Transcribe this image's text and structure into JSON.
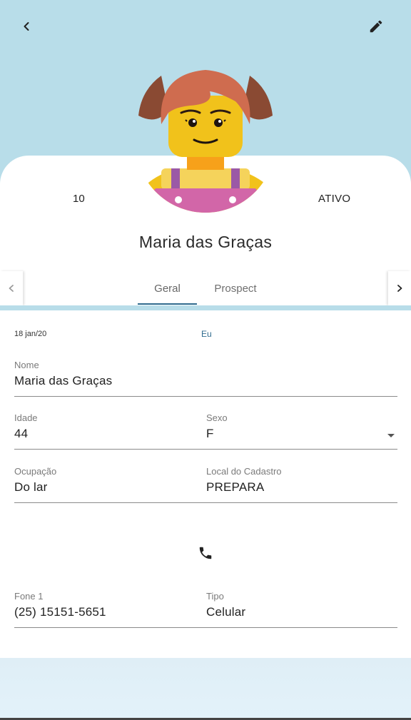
{
  "header": {
    "back_icon": "chevron-left-icon",
    "edit_icon": "pencil-icon",
    "background_color": "#b8dde9"
  },
  "profile": {
    "avatar": "lego-girl-avatar",
    "stat_left": "10",
    "stat_right": "ATIVO",
    "name": "Maria das Graças"
  },
  "tabs": {
    "items": [
      {
        "label": "Geral",
        "active": true
      },
      {
        "label": "Prospect",
        "active": false
      }
    ],
    "accent_color": "#2f6b8e"
  },
  "form": {
    "date": "18 jan/20",
    "author": "Eu",
    "fields": {
      "nome": {
        "label": "Nome",
        "value": "Maria das Graças"
      },
      "idade": {
        "label": "Idade",
        "value": "44"
      },
      "sexo": {
        "label": "Sexo",
        "value": "F"
      },
      "ocupacao": {
        "label": "Ocupação",
        "value": "Do lar"
      },
      "local": {
        "label": "Local do Cadastro",
        "value": "PREPARA"
      },
      "fone1": {
        "label": "Fone 1",
        "value": "(25) 15151-5651"
      },
      "tipo": {
        "label": "Tipo",
        "value": "Celular"
      }
    },
    "contact_icon": "phone-icon"
  }
}
